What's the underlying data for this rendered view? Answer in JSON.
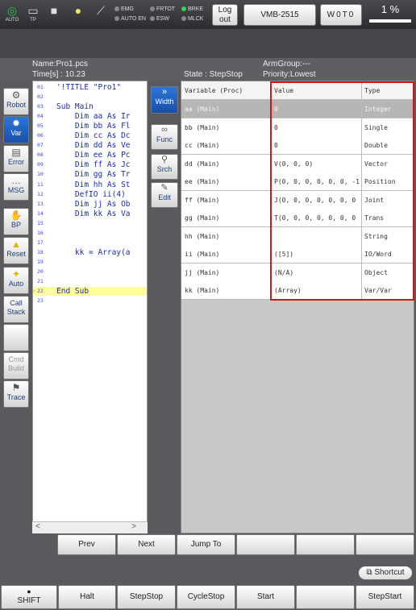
{
  "topbar": {
    "icons": [
      {
        "name": "auto-mode-icon",
        "label": "AUTO"
      },
      {
        "name": "tp-icon",
        "label": "TP"
      },
      {
        "name": "stop-square-icon",
        "label": ""
      },
      {
        "name": "lightbulb-icon",
        "label": ""
      },
      {
        "name": "wrench-icon",
        "label": ""
      }
    ],
    "leds": {
      "emg": "EMG",
      "auto_en": "AUTO EN",
      "frtot": "FRTOT",
      "esw": "ESW",
      "brke": "BRKE",
      "mlck": "MLCK"
    },
    "logout_label": "Log out",
    "robot_model": "VMB-2515",
    "work_label": "W0T0",
    "speed": "1 %",
    "led_on_color": "#33d45a"
  },
  "status": {
    "name": "Name:Pro1.pcs",
    "time": "Time[s] : 10.23",
    "state": "State : StepStop",
    "armgroup": "ArmGroup:---",
    "priority": "Priority:Lowest"
  },
  "left_buttons": [
    {
      "label": "Robot",
      "icon": "robot-arm-icon"
    },
    {
      "label": "Var",
      "icon": "var-gear-icon",
      "active": true
    },
    {
      "label": "Error",
      "icon": "error-doc-icon"
    },
    {
      "label": "MSG",
      "icon": "message-bubble-icon"
    },
    {
      "label": "BP",
      "icon": "hand-icon"
    },
    {
      "label": "Reset",
      "icon": "warning-triangle-icon"
    },
    {
      "label": "Auto",
      "icon": "auto-star-icon"
    },
    {
      "label": "Call Stack",
      "icon": ""
    },
    {
      "label": "",
      "icon": ""
    },
    {
      "label": "Cmd Build",
      "icon": "",
      "disabled": true
    },
    {
      "label": "Trace",
      "icon": "trace-icon"
    }
  ],
  "code_lines": [
    {
      "n": "01",
      "text": "'!TITLE \"Pro1\""
    },
    {
      "n": "02",
      "text": ""
    },
    {
      "n": "03",
      "text": "Sub Main"
    },
    {
      "n": "04",
      "text": "    Dim aa As Ir"
    },
    {
      "n": "05",
      "text": "    Dim bb As Fl"
    },
    {
      "n": "06",
      "text": "    Dim cc As Dc"
    },
    {
      "n": "07",
      "text": "    Dim dd As Ve"
    },
    {
      "n": "08",
      "text": "    Dim ee As Pc"
    },
    {
      "n": "09",
      "text": "    Dim ff As Jc"
    },
    {
      "n": "10",
      "text": "    Dim gg As Tr"
    },
    {
      "n": "11",
      "text": "    Dim hh As St"
    },
    {
      "n": "12",
      "text": "    DefIO ii(4)"
    },
    {
      "n": "13",
      "text": "    Dim jj As Ob"
    },
    {
      "n": "14",
      "text": "    Dim kk As Va"
    },
    {
      "n": "15",
      "text": ""
    },
    {
      "n": "16",
      "text": ""
    },
    {
      "n": "17",
      "text": ""
    },
    {
      "n": "18",
      "text": "    kk = Array(a"
    },
    {
      "n": "19",
      "text": ""
    },
    {
      "n": "20",
      "text": ""
    },
    {
      "n": "21",
      "text": ""
    },
    {
      "n": "22",
      "text": "End Sub",
      "current": true
    },
    {
      "n": "23",
      "text": ""
    }
  ],
  "code_scroll": {
    "left": "<",
    "right": ">"
  },
  "mid_buttons": [
    {
      "label": "Width",
      "icon": "double-chevron-right-icon",
      "glyph": "»",
      "active": true
    },
    {
      "label": "Func",
      "icon": "function-icon",
      "glyph": "∞"
    },
    {
      "label": "Srch",
      "icon": "search-icon",
      "glyph": "⚲"
    },
    {
      "label": "Edit",
      "icon": "pencil-icon",
      "glyph": "✎"
    }
  ],
  "var_table": {
    "headers": [
      "Variable (Proc)",
      "Value",
      "Type"
    ],
    "rows": [
      {
        "var": "aa (Main)",
        "value": "0",
        "type": "Integer",
        "selected": true
      },
      {
        "var": "bb (Main)",
        "value": "0",
        "type": "Single"
      },
      {
        "var": "cc (Main)",
        "value": "0",
        "type": "Double"
      },
      {
        "var": "dd (Main)",
        "value": "V(0, 0, 0)",
        "type": "Vector"
      },
      {
        "var": "ee (Main)",
        "value": "P(0, 0, 0, 0, 0, 0, -1",
        "type": "Position"
      },
      {
        "var": "ff (Main)",
        "value": "J(0, 0, 0, 0, 0, 0, 0",
        "type": "Joint"
      },
      {
        "var": "gg (Main)",
        "value": "T(0, 0, 0, 0, 0, 0, 0",
        "type": "Trans"
      },
      {
        "var": "hh (Main)",
        "value": "",
        "type": "String"
      },
      {
        "var": "ii (Main)",
        "value": "([5])",
        "type": "IO/Word"
      },
      {
        "var": "jj (Main)",
        "value": "(N/A)",
        "type": "Object"
      },
      {
        "var": "kk (Main)",
        "value": "(Array)",
        "type": "Var/Var"
      }
    ]
  },
  "nav_buttons": [
    "Prev",
    "Next",
    "Jump To",
    "",
    "",
    ""
  ],
  "shortcut_label": "Shortcut",
  "action_buttons": [
    "SHIFT",
    "Halt",
    "StepStop",
    "CycleStop",
    "Start",
    "",
    "StepStart"
  ],
  "colors": {
    "highlight": "#d11414",
    "current_line": "#ffff9c",
    "accent": "#1a4fa8"
  }
}
